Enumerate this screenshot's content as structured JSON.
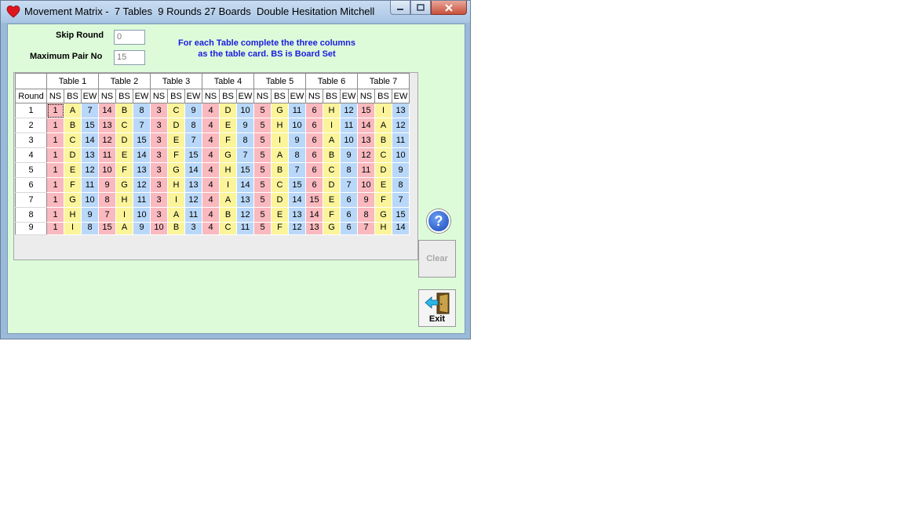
{
  "window": {
    "title": "Movement Matrix -  7 Tables  9 Rounds 27 Boards  Double Hesitation Mitchell"
  },
  "form": {
    "skip_round_label": "Skip Round",
    "skip_round_value": "0",
    "max_pair_label": "Maximum Pair No",
    "max_pair_value": "15",
    "note_line1": "For each Table complete the three columns",
    "note_line2": "as the table card. BS is Board Set"
  },
  "grid": {
    "tables": [
      "Table 1",
      "Table 2",
      "Table 3",
      "Table 4",
      "Table 5",
      "Table 6",
      "Table 7"
    ],
    "round_header": "Round",
    "col_headers": [
      "NS",
      "BS",
      "EW"
    ],
    "rows": [
      {
        "round": "1",
        "cells": [
          "1",
          "A",
          "7",
          "14",
          "B",
          "8",
          "3",
          "C",
          "9",
          "4",
          "D",
          "10",
          "5",
          "G",
          "11",
          "6",
          "H",
          "12",
          "15",
          "I",
          "13"
        ]
      },
      {
        "round": "2",
        "cells": [
          "1",
          "B",
          "15",
          "13",
          "C",
          "7",
          "3",
          "D",
          "8",
          "4",
          "E",
          "9",
          "5",
          "H",
          "10",
          "6",
          "I",
          "11",
          "14",
          "A",
          "12"
        ]
      },
      {
        "round": "3",
        "cells": [
          "1",
          "C",
          "14",
          "12",
          "D",
          "15",
          "3",
          "E",
          "7",
          "4",
          "F",
          "8",
          "5",
          "I",
          "9",
          "6",
          "A",
          "10",
          "13",
          "B",
          "11"
        ]
      },
      {
        "round": "4",
        "cells": [
          "1",
          "D",
          "13",
          "11",
          "E",
          "14",
          "3",
          "F",
          "15",
          "4",
          "G",
          "7",
          "5",
          "A",
          "8",
          "6",
          "B",
          "9",
          "12",
          "C",
          "10"
        ]
      },
      {
        "round": "5",
        "cells": [
          "1",
          "E",
          "12",
          "10",
          "F",
          "13",
          "3",
          "G",
          "14",
          "4",
          "H",
          "15",
          "5",
          "B",
          "7",
          "6",
          "C",
          "8",
          "11",
          "D",
          "9"
        ]
      },
      {
        "round": "6",
        "cells": [
          "1",
          "F",
          "11",
          "9",
          "G",
          "12",
          "3",
          "H",
          "13",
          "4",
          "I",
          "14",
          "5",
          "C",
          "15",
          "6",
          "D",
          "7",
          "10",
          "E",
          "8"
        ]
      },
      {
        "round": "7",
        "cells": [
          "1",
          "G",
          "10",
          "8",
          "H",
          "11",
          "3",
          "I",
          "12",
          "4",
          "A",
          "13",
          "5",
          "D",
          "14",
          "15",
          "E",
          "6",
          "9",
          "F",
          "7"
        ]
      },
      {
        "round": "8",
        "cells": [
          "1",
          "H",
          "9",
          "7",
          "I",
          "10",
          "3",
          "A",
          "11",
          "4",
          "B",
          "12",
          "5",
          "E",
          "13",
          "14",
          "F",
          "6",
          "8",
          "G",
          "15"
        ]
      },
      {
        "round": "9",
        "cells": [
          "1",
          "I",
          "8",
          "15",
          "A",
          "9",
          "10",
          "B",
          "3",
          "4",
          "C",
          "11",
          "5",
          "F",
          "12",
          "13",
          "G",
          "6",
          "7",
          "H",
          "14"
        ]
      }
    ]
  },
  "buttons": {
    "help_symbol": "?",
    "clear_label": "Clear",
    "exit_label": "Exit"
  },
  "colors": {
    "ns": "#f9b9bf",
    "bs": "#fbf49a",
    "ew": "#b9d8f9",
    "client_bg": "#ddfbd9",
    "note_text": "#1b1be0"
  }
}
